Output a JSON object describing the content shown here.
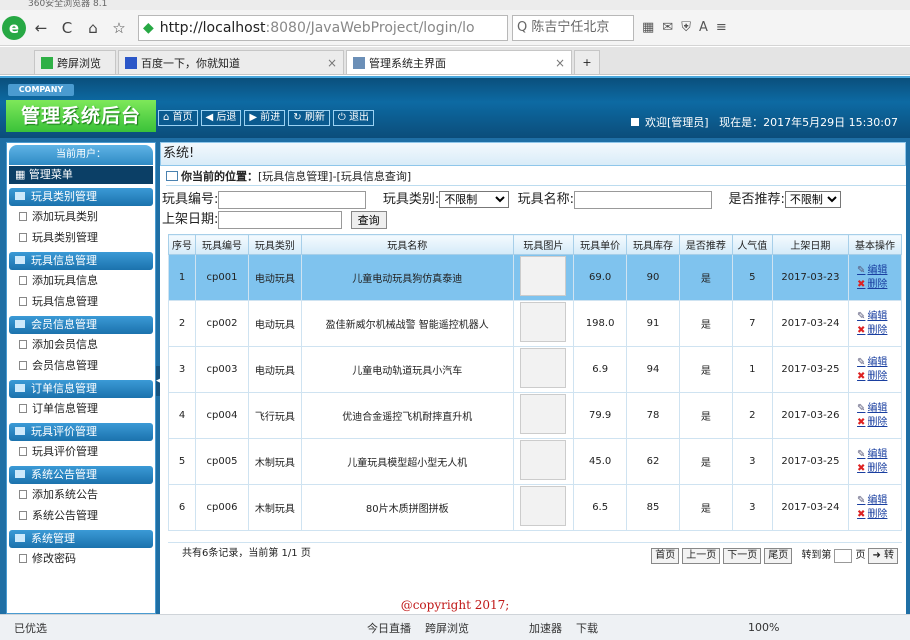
{
  "browser": {
    "title": "360安全浏览器 8.1",
    "back": "←",
    "forward": "→",
    "refresh": "C",
    "home": "⌂",
    "favorite": "☆",
    "url_host": "http://localhost",
    "url_rest": ":8080/JavaWebProject/login/lo",
    "search_text": "陈吉宁任北京",
    "tabs": [
      {
        "label": "跨屏浏览"
      },
      {
        "label": "百度一下，你就知道"
      },
      {
        "label": "管理系统主界面"
      }
    ]
  },
  "header": {
    "company": "COMPANY",
    "title": "管理系统后台",
    "buttons": [
      "首页",
      "后退",
      "前进",
      "刷新",
      "退出"
    ],
    "welcome": "欢迎[管理员]",
    "time": "现在是：2017年5月29日 15:30:07"
  },
  "sidebar": {
    "current_user": "当前用户：",
    "main_menu": "管理菜单",
    "sections": [
      {
        "title": "玩具类别管理",
        "items": [
          "添加玩具类别",
          "玩具类别管理"
        ]
      },
      {
        "title": "玩具信息管理",
        "items": [
          "添加玩具信息",
          "玩具信息管理"
        ]
      },
      {
        "title": "会员信息管理",
        "items": [
          "添加会员信息",
          "会员信息管理"
        ]
      },
      {
        "title": "订单信息管理",
        "items": [
          "订单信息管理"
        ]
      },
      {
        "title": "玩具评价管理",
        "items": [
          "玩具评价管理"
        ]
      },
      {
        "title": "系统公告管理",
        "items": [
          "添加系统公告",
          "系统公告管理"
        ]
      },
      {
        "title": "系统管理",
        "items": [
          "修改密码"
        ]
      }
    ]
  },
  "content": {
    "banner": "系统!",
    "location_label": "你当前的位置：",
    "location_path": "[玩具信息管理]-[玩具信息查询]",
    "search": {
      "code_label": "玩具编号:",
      "type_label": "玩具类别:",
      "type_value": "不限制",
      "name_label": "玩具名称:",
      "rec_label": "是否推荐:",
      "rec_value": "不限制",
      "date_label": "上架日期:",
      "query_button": "查询"
    },
    "columns": [
      "序号",
      "玩具编号",
      "玩具类别",
      "玩具名称",
      "玩具图片",
      "玩具单价",
      "玩具库存",
      "是否推荐",
      "人气值",
      "上架日期",
      "基本操作"
    ],
    "rows": [
      {
        "no": "1",
        "code": "cp001",
        "type": "电动玩具",
        "name": "儿童电动玩具狗仿真泰迪",
        "price": "69.0",
        "stock": "90",
        "rec": "是",
        "hits": "5",
        "date": "2017-03-23"
      },
      {
        "no": "2",
        "code": "cp002",
        "type": "电动玩具",
        "name": "盈佳新威尔机械战警 智能遥控机器人",
        "price": "198.0",
        "stock": "91",
        "rec": "是",
        "hits": "7",
        "date": "2017-03-24"
      },
      {
        "no": "3",
        "code": "cp003",
        "type": "电动玩具",
        "name": "儿童电动轨道玩具小汽车",
        "price": "6.9",
        "stock": "94",
        "rec": "是",
        "hits": "1",
        "date": "2017-03-25"
      },
      {
        "no": "4",
        "code": "cp004",
        "type": "飞行玩具",
        "name": "优迪合金遥控飞机耐摔直升机",
        "price": "79.9",
        "stock": "78",
        "rec": "是",
        "hits": "2",
        "date": "2017-03-26"
      },
      {
        "no": "5",
        "code": "cp005",
        "type": "木制玩具",
        "name": "儿童玩具模型超小型无人机",
        "price": "45.0",
        "stock": "62",
        "rec": "是",
        "hits": "3",
        "date": "2017-03-25"
      },
      {
        "no": "6",
        "code": "cp006",
        "type": "木制玩具",
        "name": "80片木质拼图拼板",
        "price": "6.5",
        "stock": "85",
        "rec": "是",
        "hits": "3",
        "date": "2017-03-24"
      }
    ],
    "edit_label": "编辑",
    "delete_label": "删除",
    "pager": {
      "summary": "共有6条记录，当前第 1/1 页",
      "first": "首页",
      "prev": "上一页",
      "next": "下一页",
      "last": "尾页",
      "goto_label": "转到第",
      "page_unit": "页",
      "go": "转"
    }
  },
  "footer": {
    "copyright": "@copyright 2017;"
  },
  "statusbar": {
    "left": "已优选",
    "items": [
      "今日直播",
      "跨屏浏览",
      "加速器",
      "下载",
      "100%"
    ]
  }
}
